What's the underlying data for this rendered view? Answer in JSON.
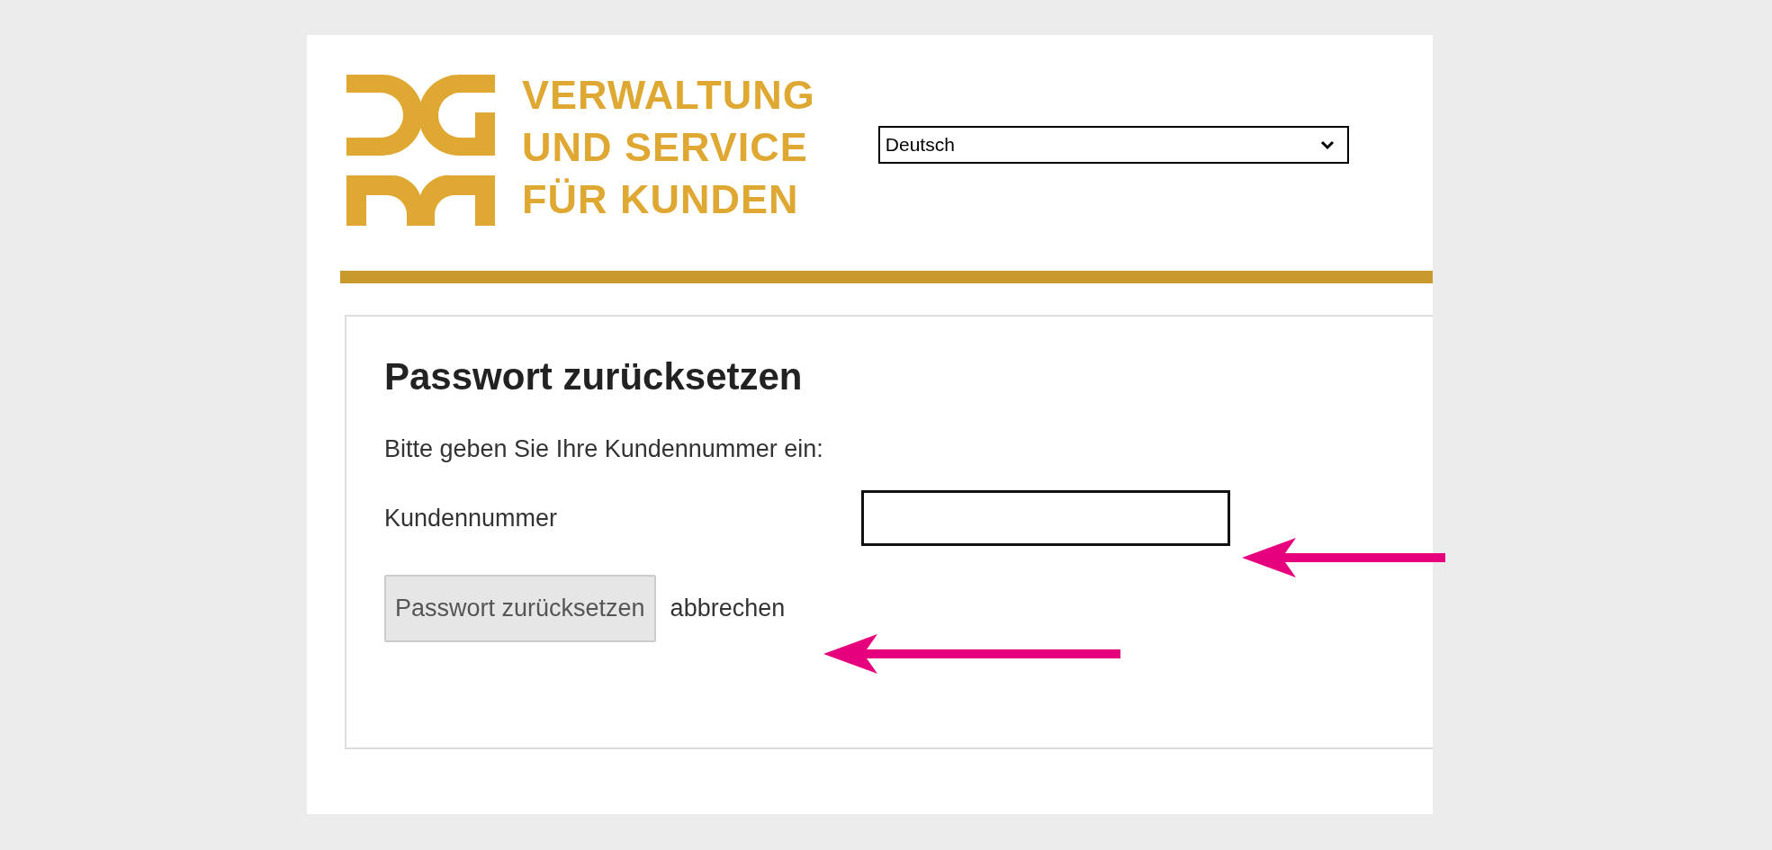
{
  "logo": {
    "lines": [
      "VERWALTUNG",
      "UND SERVICE",
      "FÜR KUNDEN"
    ]
  },
  "language_select": {
    "value": "Deutsch"
  },
  "form": {
    "title": "Passwort zurücksetzen",
    "instruction": "Bitte geben Sie Ihre Kundennummer ein:",
    "field": {
      "label": "Kundennummer"
    },
    "submit_button": "Passwort zurücksetzen",
    "cancel_link": "abbrechen"
  }
}
